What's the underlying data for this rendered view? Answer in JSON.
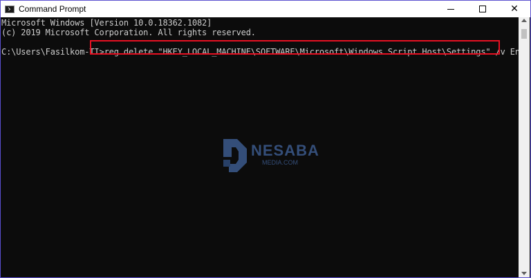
{
  "window": {
    "title": "Command Prompt",
    "controls": {
      "minimize": "–",
      "maximize": "□",
      "close": "✕"
    }
  },
  "console": {
    "lines": [
      "Microsoft Windows [Version 10.0.18362.1082]",
      "(c) 2019 Microsoft Corporation. All rights reserved."
    ],
    "prompt": "C:\\Users\\Fasilkom-TI>",
    "command": "reg delete \"HKEY_LOCAL_MACHINE\\SOFTWARE\\Microsoft\\Windows Script Host\\Settings\" /v Enabled /f"
  },
  "watermark": {
    "brand": "NESABA",
    "sub": "MEDIA.COM"
  },
  "colors": {
    "background": "#0c0c0c",
    "text": "#cccccc",
    "highlight": "#e81123",
    "border": "#5a4fcf",
    "watermark": "#3c5a8c"
  }
}
